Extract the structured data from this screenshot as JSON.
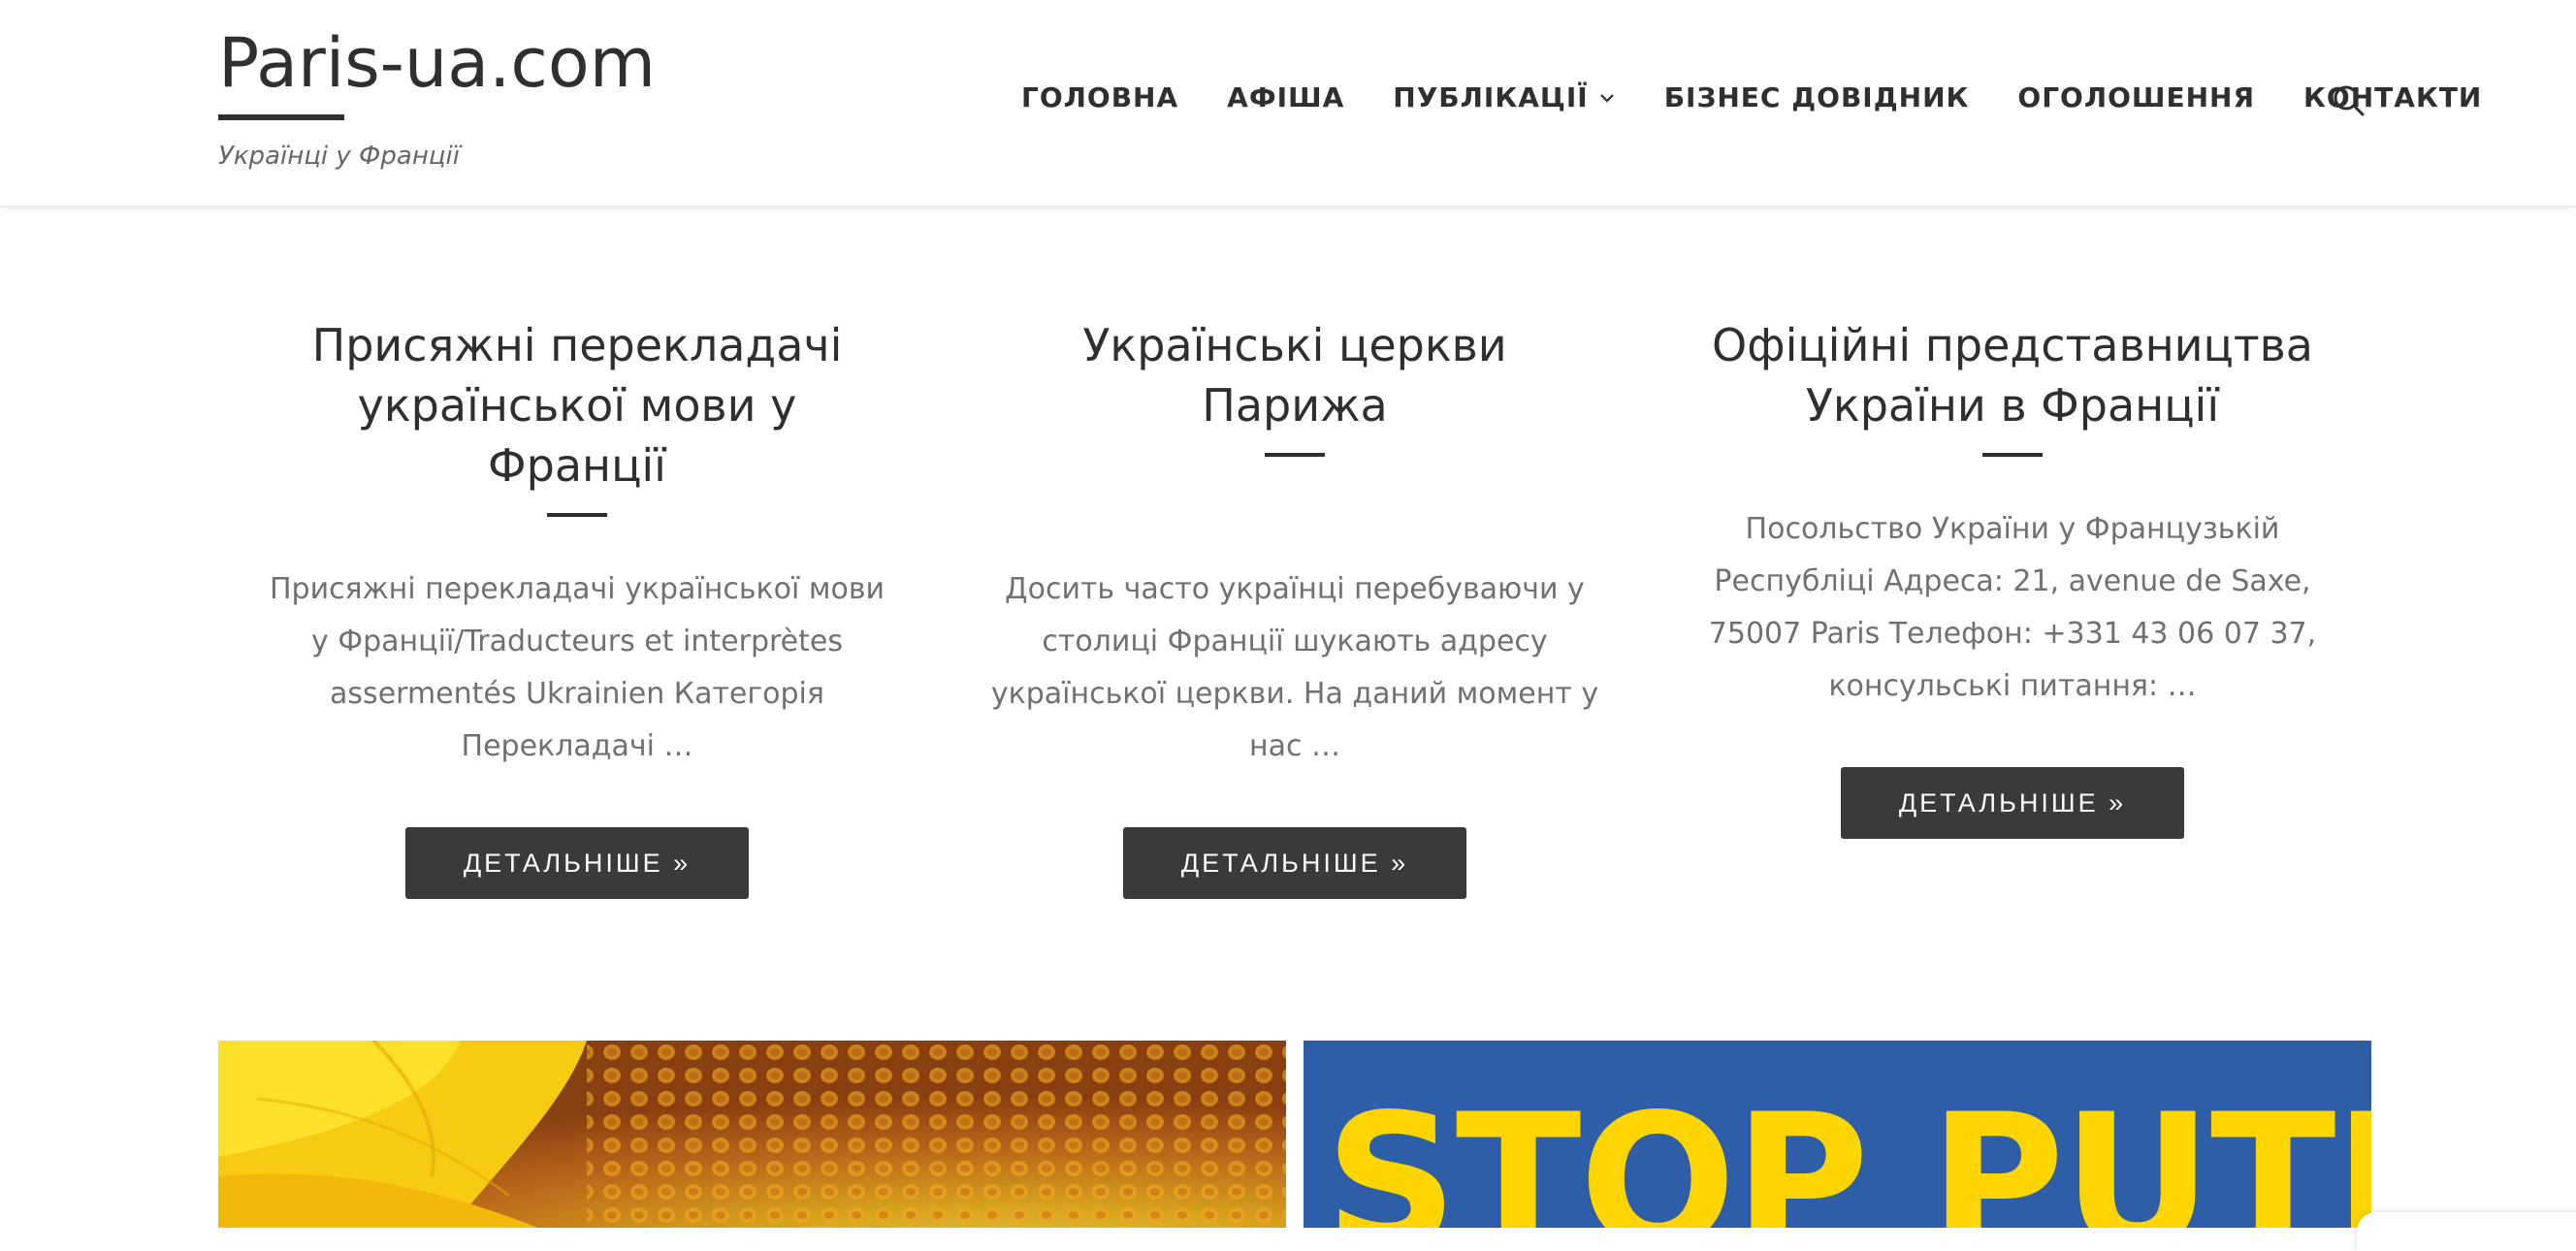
{
  "site": {
    "title": "Paris-ua.com",
    "tagline": "Українці у Франції"
  },
  "nav": {
    "items": [
      {
        "label": "ГОЛОВНА"
      },
      {
        "label": "АФІША"
      },
      {
        "label": "ПУБЛІКАЦІЇ",
        "has_dropdown": true
      },
      {
        "label": "БІЗНЕС ДОВІДНИК"
      },
      {
        "label": "ОГОЛОШЕННЯ"
      },
      {
        "label": "КОНТАКТИ"
      }
    ],
    "search_icon": "search-icon",
    "dropdown_icon": "chevron-down-icon"
  },
  "featured": [
    {
      "title": "Присяжні перекладачі української мови у  Франції",
      "excerpt": "Присяжні перекладачі української мови у  Франції/Traducteurs et interprètes assermentés Ukrainien Категорія Перекладачі …",
      "button": "ДЕТАЛЬНІШЕ »"
    },
    {
      "title": "Українські церкви Парижа",
      "excerpt": "Досить часто українці перебуваючи у столиці Франції шукають адресу української церкви. На даний момент у нас …",
      "button": "ДЕТАЛЬНІШЕ »"
    },
    {
      "title": "Офіційні представництва України в Франції",
      "excerpt": "Посольство України у Французькій Республіці Адреса: 21, avenue de Saxe, 75007 Paris Телефон: +331 43 06 07 37, консульські питання: …",
      "button": "ДЕТАЛЬНІШЕ »"
    }
  ],
  "banners": {
    "left": {
      "description_icon": "sunflower-image"
    },
    "right": {
      "text": "STOP PUTIN"
    }
  },
  "colors": {
    "text_dark": "#2f2f2f",
    "text_muted": "#707070",
    "button_bg": "#3a3a3a",
    "banner_blue": "#2e5ea8",
    "banner_yellow": "#ffd500"
  }
}
